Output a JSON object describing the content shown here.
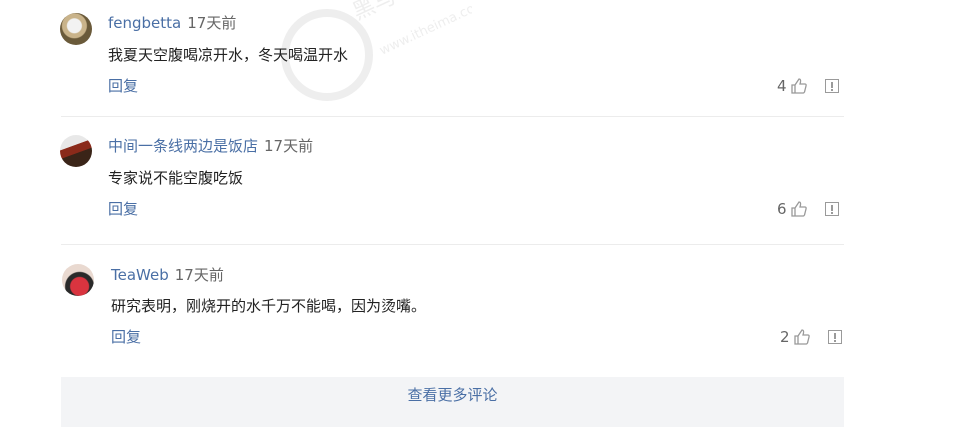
{
  "comments": [
    {
      "user": "fengbetta",
      "time": "17天前",
      "text": "我夏天空腹喝凉开水，冬天喝温开水",
      "reply": "回复",
      "likes": "4"
    },
    {
      "user": "中间一条线两边是饭店",
      "time": "17天前",
      "text": "专家说不能空腹吃饭",
      "reply": "回复",
      "likes": "6"
    },
    {
      "user": "TeaWeb",
      "time": "17天前",
      "text": "研究表明，刚烧开的水千万不能喝，因为烫嘴。",
      "reply": "回复",
      "likes": "2"
    }
  ],
  "more_label": "查看更多评论",
  "watermark": {
    "brand": "黑马",
    "url": "www.itheima.com"
  },
  "colors": {
    "link": "#4a6fa5",
    "divider": "#ececec",
    "more_bg": "#f3f4f6"
  },
  "icons": {
    "like": "thumbs-up-icon",
    "report": "report-icon"
  }
}
